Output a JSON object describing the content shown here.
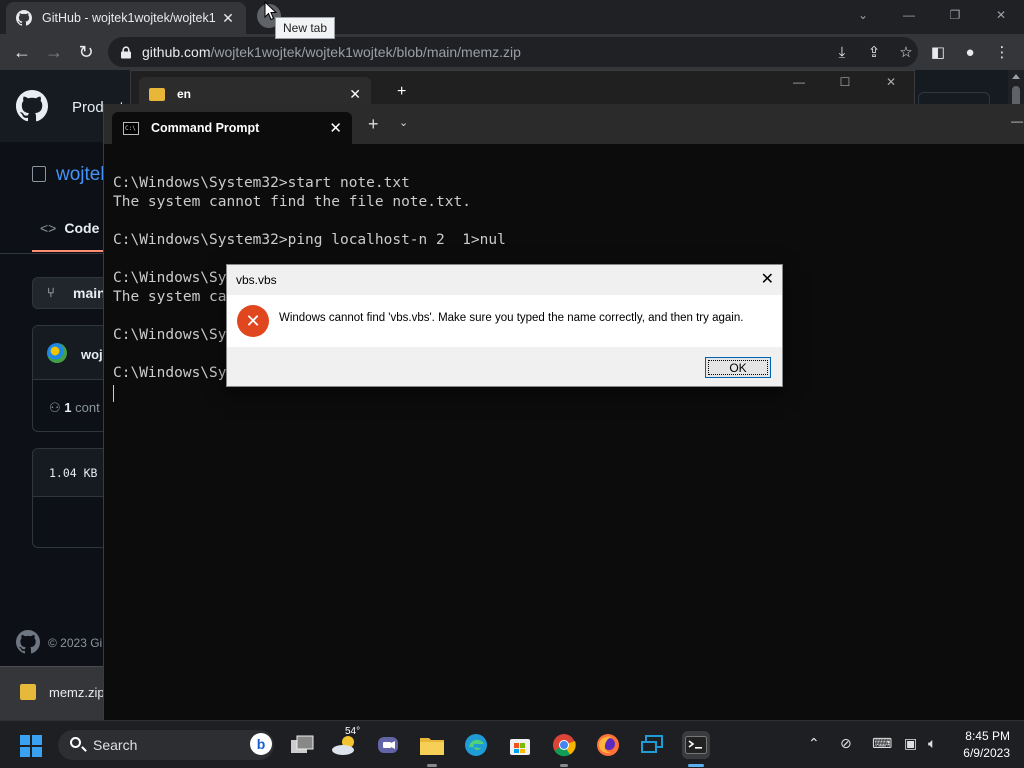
{
  "chrome": {
    "tab_title": "GitHub - wojtek1wojtek/wojtek1",
    "tooltip": "New tab",
    "url_host": "github.com",
    "url_path": "/wojtek1wojtek/wojtek1wojtek/blob/main/memz.zip"
  },
  "github": {
    "nav_product": "Product",
    "repo_name": "wojtek",
    "code_tab": "Code",
    "branch": "main",
    "owner": "woj",
    "contributors_count": "1",
    "contributors_label": "cont",
    "file_size": "1.04 KB",
    "footer": "© 2023 Gi",
    "download_file": "memz.zip"
  },
  "explorer": {
    "tab_label": "en"
  },
  "terminal": {
    "tab_label": "Command Prompt",
    "lines": [
      "C:\\Windows\\System32>start note.txt",
      "The system cannot find the file note.txt.",
      "",
      "C:\\Windows\\System32>ping localhost-n 2  1>nul",
      "",
      "C:\\Windows\\Sy",
      "The system ca",
      "",
      "C:\\Windows\\Sy",
      "",
      "C:\\Windows\\Sy"
    ]
  },
  "dialog": {
    "title": "vbs.vbs",
    "message": "Windows cannot find 'vbs.vbs'. Make sure you typed the name correctly, and then try again.",
    "ok_label": "OK"
  },
  "taskbar": {
    "search_label": "Search",
    "weather_temp": "54°",
    "time": "8:45 PM",
    "date": "6/9/2023"
  },
  "colors": {
    "accent_link": "#4493f8",
    "error": "#e0471f",
    "github_bg": "#0d1117",
    "terminal_bg": "#0c0c0c"
  }
}
